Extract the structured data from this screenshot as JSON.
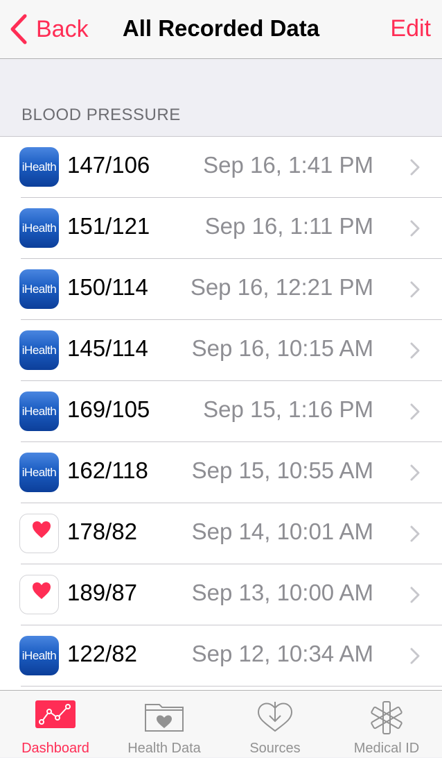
{
  "navbar": {
    "back_label": "Back",
    "title": "All Recorded Data",
    "edit_label": "Edit"
  },
  "section": {
    "header": "BLOOD PRESSURE"
  },
  "records": [
    {
      "source": "iHealth",
      "source_icon": "ihealth-app-icon",
      "reading": "147/106",
      "date": "Sep 16, 1:41 PM"
    },
    {
      "source": "iHealth",
      "source_icon": "ihealth-app-icon",
      "reading": "151/121",
      "date": "Sep 16, 1:11 PM"
    },
    {
      "source": "iHealth",
      "source_icon": "ihealth-app-icon",
      "reading": "150/114",
      "date": "Sep 16, 12:21 PM"
    },
    {
      "source": "iHealth",
      "source_icon": "ihealth-app-icon",
      "reading": "145/114",
      "date": "Sep 16, 10:15 AM"
    },
    {
      "source": "iHealth",
      "source_icon": "ihealth-app-icon",
      "reading": "169/105",
      "date": "Sep 15, 1:16 PM"
    },
    {
      "source": "iHealth",
      "source_icon": "ihealth-app-icon",
      "reading": "162/118",
      "date": "Sep 15, 10:55 AM"
    },
    {
      "source": "Health",
      "source_icon": "health-heart-app-icon",
      "reading": "178/82",
      "date": "Sep 14, 10:01 AM"
    },
    {
      "source": "Health",
      "source_icon": "health-heart-app-icon",
      "reading": "189/87",
      "date": "Sep 13, 10:00 AM"
    },
    {
      "source": "iHealth",
      "source_icon": "ihealth-app-icon",
      "reading": "122/82",
      "date": "Sep 12, 10:34 AM"
    }
  ],
  "tabbar": {
    "tabs": [
      {
        "label": "Dashboard",
        "icon": "dashboard-graph-icon",
        "active": true
      },
      {
        "label": "Health Data",
        "icon": "health-data-folder-icon",
        "active": false
      },
      {
        "label": "Sources",
        "icon": "sources-download-heart-icon",
        "active": false
      },
      {
        "label": "Medical ID",
        "icon": "medical-id-asterisk-icon",
        "active": false
      }
    ]
  },
  "colors": {
    "accent": "#ff2d55",
    "secondary_text": "#8e8e93",
    "background": "#efeff4"
  }
}
